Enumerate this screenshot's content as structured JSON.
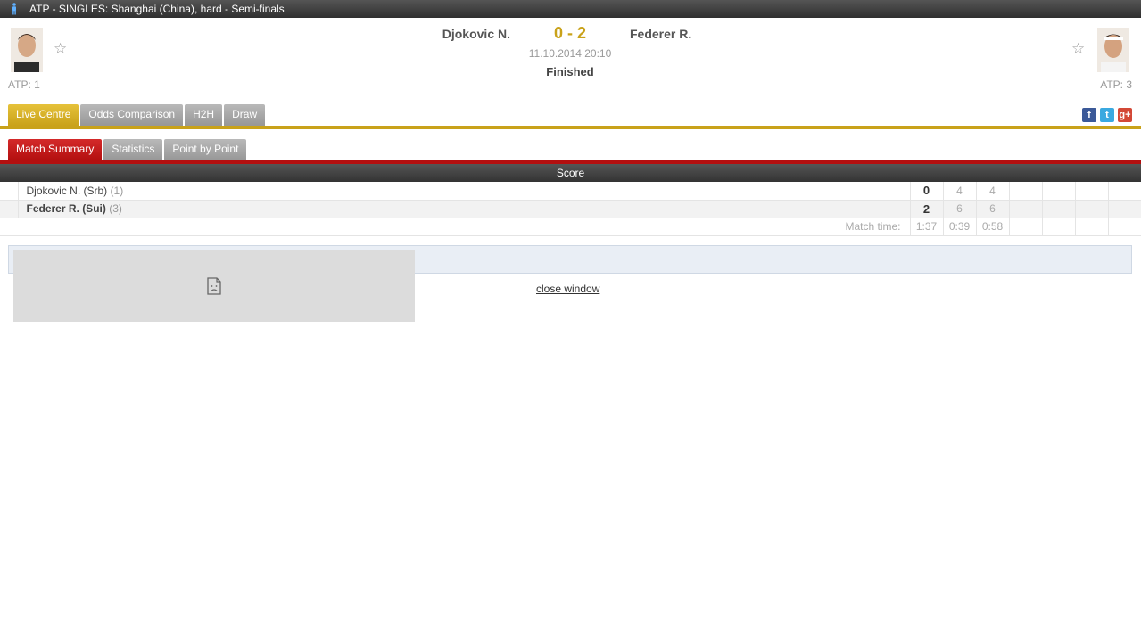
{
  "window": {
    "title": "ATP - SINGLES: Shanghai (China), hard - Semi-finals",
    "icon": "tennis-player-icon"
  },
  "match": {
    "home": {
      "name": "Djokovic N.",
      "rank": "ATP: 1"
    },
    "away": {
      "name": "Federer R.",
      "rank": "ATP: 3"
    },
    "score": "0 - 2",
    "datetime": "11.10.2014 20:10",
    "status": "Finished"
  },
  "tabs_main": [
    "Live Centre",
    "Odds Comparison",
    "H2H",
    "Draw"
  ],
  "tabs_main_active": 0,
  "tabs_sub": [
    "Match Summary",
    "Statistics",
    "Point by Point"
  ],
  "tabs_sub_active": 0,
  "social": [
    "f",
    "t",
    "g+"
  ],
  "scoreboard": {
    "header": "Score",
    "rows": [
      {
        "name": "Djokovic N. (Srb)",
        "seed": "(1)",
        "total": "0",
        "sets": [
          "4",
          "4"
        ]
      },
      {
        "name": "Federer R. (Sui)",
        "seed": "(3)",
        "total": "2",
        "sets": [
          "6",
          "6"
        ]
      }
    ],
    "match_time_label": "Match time:",
    "match_times": [
      "1:37",
      "0:39",
      "0:58"
    ]
  },
  "close_window": "close window",
  "colors": {
    "gold": "#c9a21a",
    "red": "#b30f0f",
    "dark_bar": "#333333"
  }
}
